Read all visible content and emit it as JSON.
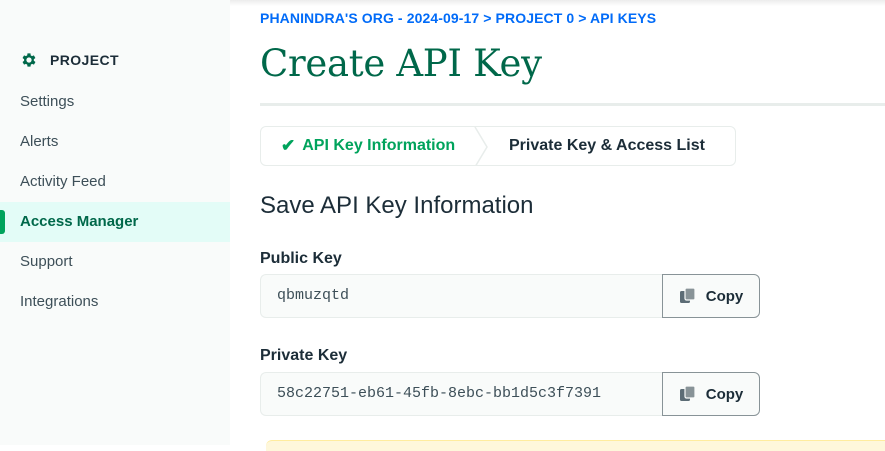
{
  "sidebar": {
    "header": "PROJECT",
    "items": [
      {
        "label": "Settings"
      },
      {
        "label": "Alerts"
      },
      {
        "label": "Activity Feed"
      },
      {
        "label": "Access Manager"
      },
      {
        "label": "Support"
      },
      {
        "label": "Integrations"
      }
    ]
  },
  "breadcrumb": "PHANINDRA'S ORG - 2024-09-17 > PROJECT 0 > API KEYS",
  "page_title": "Create API Key",
  "steps": [
    {
      "label": "API Key Information",
      "status": "complete"
    },
    {
      "label": "Private Key & Access List",
      "status": "current"
    }
  ],
  "section_title": "Save API Key Information",
  "public_key": {
    "label": "Public Key",
    "value": "qbmuzqtd",
    "copy_label": "Copy"
  },
  "private_key": {
    "label": "Private Key",
    "value": "58c22751-eb61-45fb-8ebc-bb1d5c3f7391",
    "copy_label": "Copy"
  },
  "colors": {
    "brand_green": "#00684a",
    "accent_green": "#00a35c",
    "link_blue": "#016bf8",
    "active_bg": "#e3fcf7"
  }
}
